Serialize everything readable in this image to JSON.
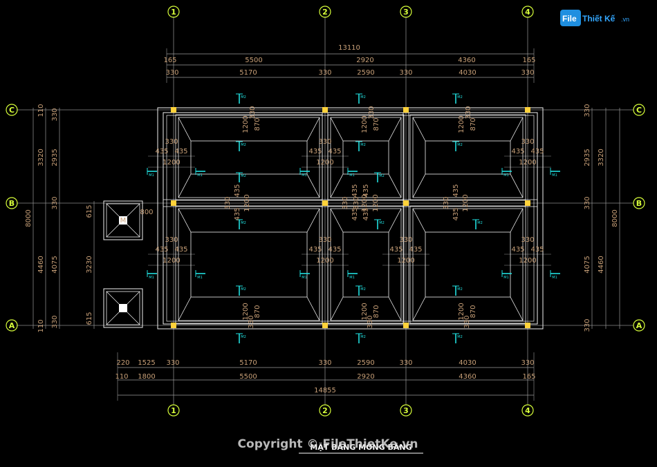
{
  "drawing_title": "MẶT BẰNG MÓNG BĂNG",
  "watermark": "Copyright © FileThietKe.vn",
  "logo": {
    "file": "File",
    "thiet": "Thiết Kế",
    "vn": ".vn"
  },
  "axes_vertical": [
    "1",
    "2",
    "3",
    "4"
  ],
  "axes_horizontal": [
    "C",
    "B",
    "A"
  ],
  "top_dims": {
    "overall": "13110",
    "row1": [
      "165",
      "5500",
      "2920",
      "4360",
      "165"
    ],
    "row2": [
      "330",
      "5170",
      "330",
      "2590",
      "330",
      "4030",
      "330"
    ]
  },
  "bottom_dims": {
    "row1": [
      "220",
      "1525",
      "330",
      "5170",
      "330",
      "2590",
      "330",
      "4030",
      "330"
    ],
    "row2": [
      "110",
      "1800",
      "5500",
      "2920",
      "4360",
      "165"
    ],
    "overall": "14855"
  },
  "left_dims": {
    "outer": "8000",
    "mid": [
      "3320",
      "4460"
    ],
    "inner": [
      "110",
      "330",
      "2935",
      "330",
      "4075",
      "330",
      "110"
    ],
    "extra": [
      "615",
      "3230",
      "615"
    ]
  },
  "right_dims": {
    "outer": "8000",
    "mid": [
      "3320",
      "4460"
    ],
    "inner": [
      "330",
      "2935",
      "330",
      "4075",
      "330"
    ]
  },
  "footing_labels": {
    "w330": "330",
    "w435": "435",
    "w1200": "1200",
    "w870": "870",
    "w800": "800"
  },
  "section_mark": "M1",
  "section_mark_2": "M2",
  "pit_mark": "M"
}
